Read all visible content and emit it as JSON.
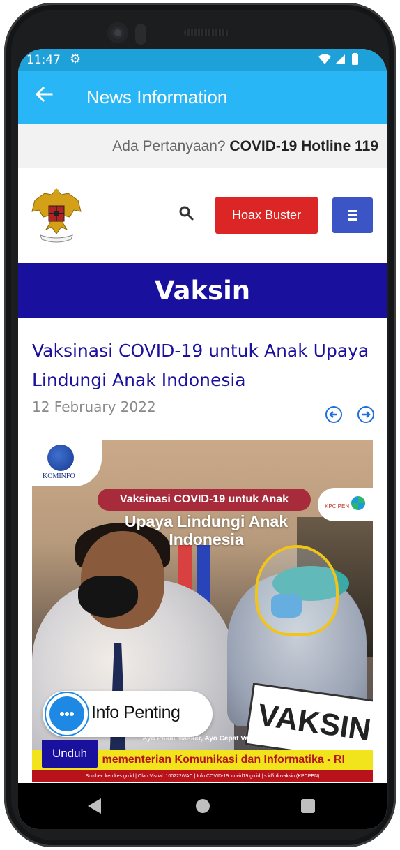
{
  "status_bar": {
    "time": "11:47",
    "settings_icon": "gear-icon",
    "indicators": "wifi-icon signal-icon battery-icon"
  },
  "app_bar": {
    "back_icon": "arrow-left-icon",
    "title": "News Information",
    "color": "#29b6f6"
  },
  "hotline": {
    "question": "Ada Pertanyaan?",
    "number": "COVID-19 Hotline 119"
  },
  "top_nav": {
    "logo": "garuda-pancasila-logo",
    "search_icon": "search-icon",
    "hoax_button": "Hoax Buster",
    "menu_icon": "hamburger-menu-icon"
  },
  "section": {
    "title": "Vaksin"
  },
  "article": {
    "title": "Vaksinasi COVID-19 untuk Anak Upaya Lindungi Anak Indonesia",
    "date": "12 February 2022",
    "prev_icon": "arrow-circle-left-icon",
    "next_icon": "arrow-circle-right-icon"
  },
  "hero_image": {
    "kominfo_label": "KOMINFO",
    "kpc_label": "KPC PEN",
    "pill_text": "Vaksinasi COVID-19 untuk Anak",
    "headline": "Upaya Lindungi Anak Indonesia",
    "sign_text": "VAKSIN",
    "footnote": "Ayo Pakai Masker, Ayo Cepat Vaksin",
    "ministry": "mementerian Komunikasi dan Informatika - RI",
    "source": "Sumber: kemkes.go.id | Olah Visual: 100222/VAC | Info COVID-19: covid19.go.id | s.id/infovaksin (KPCPEN)"
  },
  "floating": {
    "info_label": "Info Penting",
    "info_icon": "ellipsis-icon",
    "unduh_button": "Unduh"
  },
  "nav_bar": {
    "back": "nav-back-icon",
    "home": "nav-home-icon",
    "recent": "nav-recent-icon"
  }
}
